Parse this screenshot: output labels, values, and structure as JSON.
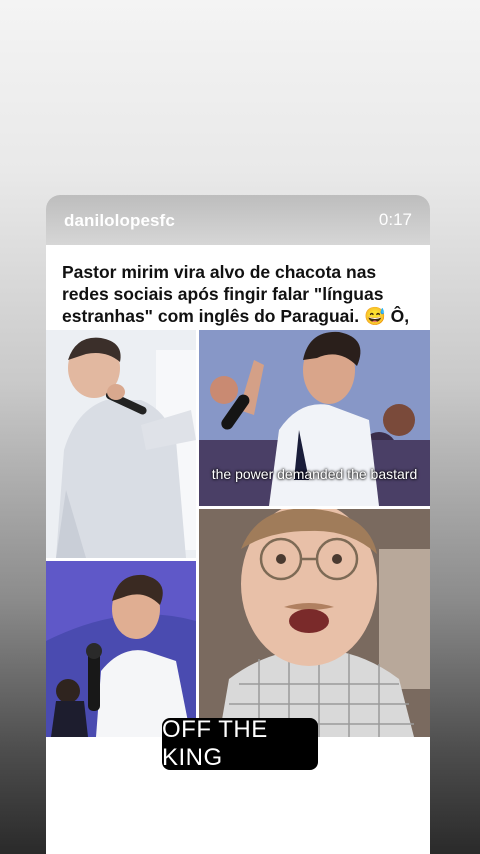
{
  "story": {
    "username": "danilolopesfc",
    "time": "0:17",
    "headline": "Pastor mirim vira alvo de chacota nas redes sociais após fingir falar \"línguas estranhas\" com inglês do Paraguai. 😅 Ô, glória, irmãos!",
    "video_subtitle": "the power demanded the bastard",
    "caption_sticker": "OFF THE KING"
  }
}
